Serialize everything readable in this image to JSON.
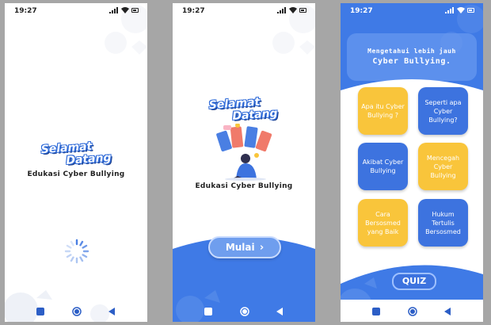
{
  "status": {
    "time": "19:27"
  },
  "screen1": {
    "logo_line1": "Selamat",
    "logo_line2": "Datang",
    "subtitle": "Edukasi Cyber Bullying"
  },
  "screen2": {
    "logo_line1": "Selamat",
    "logo_line2": "Datang",
    "subtitle": "Edukasi Cyber Bullying",
    "start_label": "Mulai",
    "start_arrow": "›"
  },
  "screen3": {
    "header_line1": "Mengetahui lebih jauh",
    "header_line2": "Cyber Bullying.",
    "menu": [
      {
        "label": "Apa itu Cyber Bullying ?",
        "color": "#f9c53b"
      },
      {
        "label": "Seperti apa Cyber Bullying?",
        "color": "#3d73df"
      },
      {
        "label": "Akibat Cyber Bullying",
        "color": "#3d73df"
      },
      {
        "label": "Mencegah Cyber Bullying",
        "color": "#f9c53b"
      },
      {
        "label": "Cara Bersosmed yang Baik",
        "color": "#f9c53b"
      },
      {
        "label": "Hukum Tertulis Bersosmed",
        "color": "#3d73df"
      }
    ],
    "quiz_label": "QUIZ"
  },
  "colors": {
    "primary_blue": "#3f7ae6",
    "accent_yellow": "#f9c53b",
    "nav_blue": "#2c5ec6"
  },
  "icons": [
    "signal-icon",
    "wifi-icon",
    "battery-icon",
    "square-nav-icon",
    "home-nav-icon",
    "back-nav-icon",
    "loading-spinner-icon"
  ]
}
